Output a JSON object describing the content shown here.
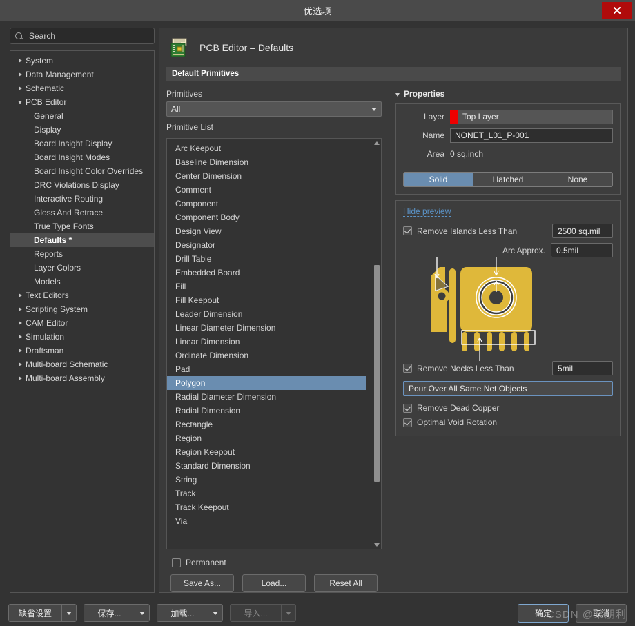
{
  "window": {
    "title": "优选项",
    "close_label": "✕"
  },
  "sidebar": {
    "search_placeholder": "Search",
    "search_value": "",
    "search_icon": "search-icon",
    "items": [
      {
        "label": "System",
        "level": 0,
        "expanded": false,
        "selected": false
      },
      {
        "label": "Data Management",
        "level": 0,
        "expanded": false,
        "selected": false
      },
      {
        "label": "Schematic",
        "level": 0,
        "expanded": false,
        "selected": false
      },
      {
        "label": "PCB Editor",
        "level": 0,
        "expanded": true,
        "selected": false
      },
      {
        "label": "General",
        "level": 1,
        "expanded": null,
        "selected": false
      },
      {
        "label": "Display",
        "level": 1,
        "expanded": null,
        "selected": false
      },
      {
        "label": "Board Insight Display",
        "level": 1,
        "expanded": null,
        "selected": false
      },
      {
        "label": "Board Insight Modes",
        "level": 1,
        "expanded": null,
        "selected": false
      },
      {
        "label": "Board Insight Color Overrides",
        "level": 1,
        "expanded": null,
        "selected": false
      },
      {
        "label": "DRC Violations Display",
        "level": 1,
        "expanded": null,
        "selected": false
      },
      {
        "label": "Interactive Routing",
        "level": 1,
        "expanded": null,
        "selected": false
      },
      {
        "label": "Gloss And Retrace",
        "level": 1,
        "expanded": null,
        "selected": false
      },
      {
        "label": "True Type Fonts",
        "level": 1,
        "expanded": null,
        "selected": false
      },
      {
        "label": "Defaults *",
        "level": 1,
        "expanded": null,
        "selected": true
      },
      {
        "label": "Reports",
        "level": 1,
        "expanded": null,
        "selected": false
      },
      {
        "label": "Layer Colors",
        "level": 1,
        "expanded": null,
        "selected": false
      },
      {
        "label": "Models",
        "level": 1,
        "expanded": null,
        "selected": false
      },
      {
        "label": "Text Editors",
        "level": 0,
        "expanded": false,
        "selected": false
      },
      {
        "label": "Scripting System",
        "level": 0,
        "expanded": false,
        "selected": false
      },
      {
        "label": "CAM Editor",
        "level": 0,
        "expanded": false,
        "selected": false
      },
      {
        "label": "Simulation",
        "level": 0,
        "expanded": false,
        "selected": false
      },
      {
        "label": "Draftsman",
        "level": 0,
        "expanded": false,
        "selected": false
      },
      {
        "label": "Multi-board Schematic",
        "level": 0,
        "expanded": false,
        "selected": false
      },
      {
        "label": "Multi-board Assembly",
        "level": 0,
        "expanded": false,
        "selected": false
      }
    ]
  },
  "page": {
    "icon": "pcb-board-icon",
    "title": "PCB Editor – Defaults",
    "section_title": "Default Primitives"
  },
  "primitives": {
    "combo_label": "Primitives",
    "combo_value": "All",
    "list_label": "Primitive List",
    "items": [
      "Arc Keepout",
      "Baseline Dimension",
      "Center Dimension",
      "Comment",
      "Component",
      "Component Body",
      "Design View",
      "Designator",
      "Drill Table",
      "Embedded Board",
      "Fill",
      "Fill Keepout",
      "Leader Dimension",
      "Linear Diameter Dimension",
      "Linear Dimension",
      "Ordinate Dimension",
      "Pad",
      "Polygon",
      "Radial Diameter Dimension",
      "Radial Dimension",
      "Rectangle",
      "Region",
      "Region Keepout",
      "Standard Dimension",
      "String",
      "Track",
      "Track Keepout",
      "Via"
    ],
    "selected": "Polygon",
    "permanent_label": "Permanent",
    "permanent_checked": false,
    "buttons": {
      "save_as": "Save As...",
      "load": "Load...",
      "reset_all": "Reset All"
    }
  },
  "properties": {
    "title": "Properties",
    "expanded": true,
    "layer_label": "Layer",
    "layer_value": "Top Layer",
    "layer_color": "#ee0000",
    "name_label": "Name",
    "name_value": "NONET_L01_P-001",
    "area_label": "Area",
    "area_value": "0 sq.inch",
    "fill_modes": [
      "Solid",
      "Hatched",
      "None"
    ],
    "fill_mode_selected": "Solid",
    "hide_preview_label": "Hide preview",
    "remove_islands_label": "Remove Islands Less Than",
    "remove_islands_checked": true,
    "remove_islands_value": "2500 sq.mil",
    "arc_approx_label": "Arc Approx.",
    "arc_approx_value": "0.5mil",
    "remove_necks_label": "Remove Necks Less Than",
    "remove_necks_checked": true,
    "remove_necks_value": "5mil",
    "pour_over_value": "Pour Over All Same Net Objects",
    "remove_dead_copper_label": "Remove Dead Copper",
    "remove_dead_copper_checked": true,
    "optimal_void_rotation_label": "Optimal Void Rotation",
    "optimal_void_rotation_checked": true,
    "preview_graphic": "polygon-pour-preview",
    "preview_accent_color": "#dfb83a"
  },
  "footer": {
    "default_settings": "缺省设置",
    "save": "保存...",
    "load": "加载...",
    "import": "导入...",
    "import_disabled": true,
    "ok": "确定",
    "cancel": "取消",
    "watermark": "CSDN @枀朋利"
  }
}
